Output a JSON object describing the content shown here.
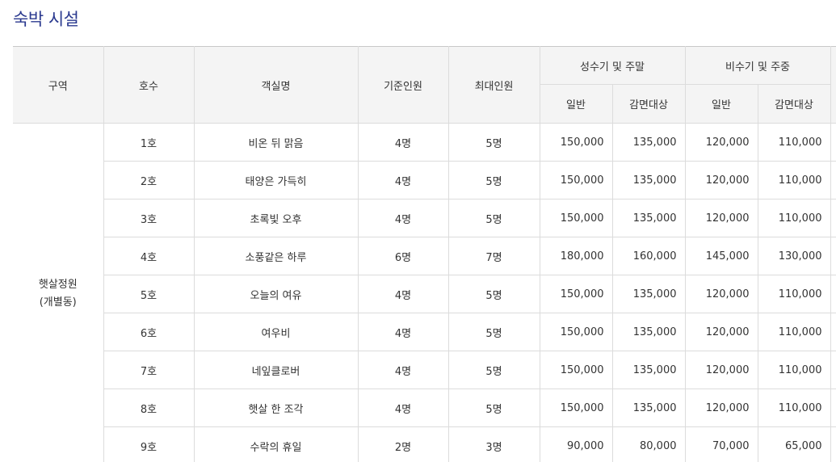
{
  "title": "숙박 시설",
  "headers": {
    "zone": "구역",
    "room_no": "호수",
    "room_name": "객실명",
    "base": "기준인원",
    "max": "최대인원",
    "peak": "성수기 및 주말",
    "offpeak": "비수기 및 주중",
    "general": "일반",
    "discount": "감면대상"
  },
  "zone": {
    "line1": "햇살정원",
    "line2": "(개별동)"
  },
  "rows": [
    {
      "no": "1호",
      "name": "비온 뒤 맑음",
      "base": "4명",
      "max": "5명",
      "peak_general": "150,000",
      "peak_discount": "135,000",
      "off_general": "120,000",
      "off_discount": "110,000"
    },
    {
      "no": "2호",
      "name": "태양은 가득히",
      "base": "4명",
      "max": "5명",
      "peak_general": "150,000",
      "peak_discount": "135,000",
      "off_general": "120,000",
      "off_discount": "110,000"
    },
    {
      "no": "3호",
      "name": "초록빛 오후",
      "base": "4명",
      "max": "5명",
      "peak_general": "150,000",
      "peak_discount": "135,000",
      "off_general": "120,000",
      "off_discount": "110,000"
    },
    {
      "no": "4호",
      "name": "소풍같은 하루",
      "base": "6명",
      "max": "7명",
      "peak_general": "180,000",
      "peak_discount": "160,000",
      "off_general": "145,000",
      "off_discount": "130,000"
    },
    {
      "no": "5호",
      "name": "오늘의 여유",
      "base": "4명",
      "max": "5명",
      "peak_general": "150,000",
      "peak_discount": "135,000",
      "off_general": "120,000",
      "off_discount": "110,000"
    },
    {
      "no": "6호",
      "name": "여우비",
      "base": "4명",
      "max": "5명",
      "peak_general": "150,000",
      "peak_discount": "135,000",
      "off_general": "120,000",
      "off_discount": "110,000"
    },
    {
      "no": "7호",
      "name": "네잎클로버",
      "base": "4명",
      "max": "5명",
      "peak_general": "150,000",
      "peak_discount": "135,000",
      "off_general": "120,000",
      "off_discount": "110,000"
    },
    {
      "no": "8호",
      "name": "햇살 한 조각",
      "base": "4명",
      "max": "5명",
      "peak_general": "150,000",
      "peak_discount": "135,000",
      "off_general": "120,000",
      "off_discount": "110,000"
    },
    {
      "no": "9호",
      "name": "수락의 휴일",
      "base": "2명",
      "max": "3명",
      "peak_general": "90,000",
      "peak_discount": "80,000",
      "off_general": "70,000",
      "off_discount": "65,000"
    }
  ]
}
